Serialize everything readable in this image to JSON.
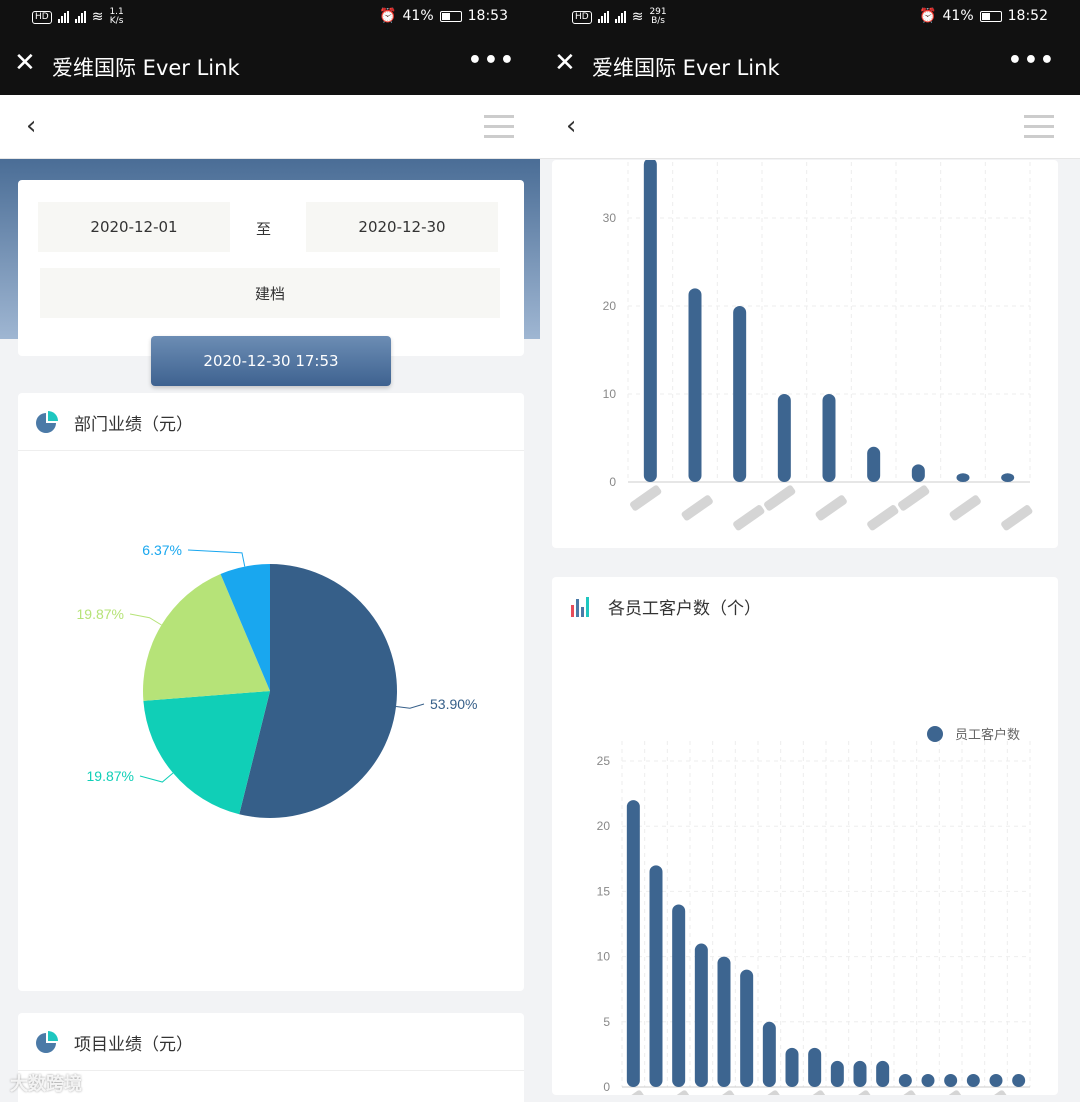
{
  "status_left": {
    "net1": "1.1",
    "net1_unit": "K/s",
    "battery": "41%",
    "time": "18:53"
  },
  "status_right": {
    "net1": "291",
    "net1_unit": "B/s",
    "battery": "41%",
    "time": "18:52"
  },
  "app": {
    "title": "爱维国际 Ever Link",
    "close": "✕",
    "more": "•••"
  },
  "nav": {
    "back": "‹"
  },
  "filter": {
    "date_from": "2020-12-01",
    "to_label": "至",
    "date_to": "2020-12-30",
    "archive_label": "建档",
    "timestamp": "2020-12-30 17:53"
  },
  "dept_card": {
    "title": "部门业绩（元）"
  },
  "project_card": {
    "title": "项目业绩（元）"
  },
  "employee_card": {
    "title": "各员工客户数（个）"
  },
  "watermark": "大数跨境",
  "colors": {
    "navy": "#365f89",
    "teal": "#10cfb7",
    "lime": "#b6e378",
    "cyan": "#19a7ef"
  },
  "chart_data": [
    {
      "type": "pie",
      "title": "部门业绩（元）",
      "slices": [
        {
          "label": "53.90%",
          "value": 53.9,
          "color": "#365f89"
        },
        {
          "label": "19.87%",
          "value": 19.87,
          "color": "#10cfb7"
        },
        {
          "label": "19.87%",
          "value": 19.87,
          "color": "#b6e378"
        },
        {
          "label": "6.37%",
          "value": 6.37,
          "color": "#19a7ef"
        }
      ]
    },
    {
      "type": "bar",
      "title": "",
      "ylim": [
        0,
        35
      ],
      "yticks": [
        0,
        10,
        20,
        30
      ],
      "values": [
        37,
        22,
        20,
        10,
        10,
        4,
        2,
        1,
        1
      ],
      "grid": true
    },
    {
      "type": "bar",
      "title": "各员工客户数（个）",
      "legend": "员工客户数",
      "legend_position": "top-right",
      "ylim": [
        0,
        25
      ],
      "yticks": [
        0,
        5,
        10,
        15,
        20,
        25
      ],
      "values": [
        22,
        17,
        14,
        11,
        10,
        9,
        5,
        3,
        3,
        2,
        2,
        2,
        1,
        1,
        1,
        1,
        1,
        1
      ],
      "grid": true
    }
  ]
}
